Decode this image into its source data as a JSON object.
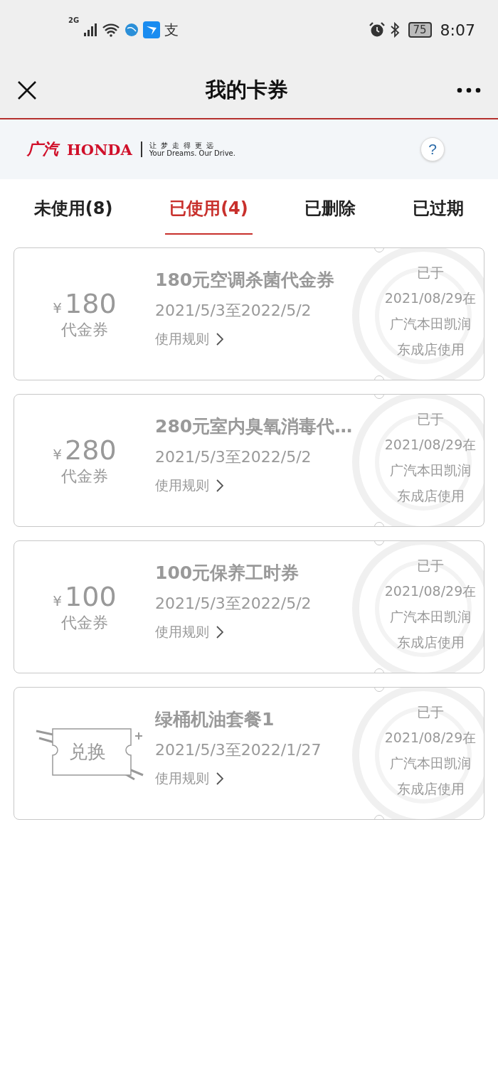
{
  "status_bar": {
    "network": "2G",
    "apps": [
      "支"
    ],
    "battery": "75",
    "time": "8:07"
  },
  "header": {
    "title": "我的卡券"
  },
  "brand": {
    "name_cn": "广汽",
    "name_en": "HONDA",
    "slogan_cn": "让梦走得更远",
    "slogan_en": "Your Dreams. Our Drive.",
    "help": "?"
  },
  "tabs": [
    {
      "label": "未使用(8)",
      "selected": false
    },
    {
      "label": "已使用(4)",
      "selected": true
    },
    {
      "label": "已删除",
      "selected": false
    },
    {
      "label": "已过期",
      "selected": false
    }
  ],
  "coupons": [
    {
      "kind": "voucher",
      "currency": "¥",
      "amount": "180",
      "type": "代金券",
      "title": "180元空调杀菌代金券",
      "validity": "2021/5/3至2022/5/2",
      "rules": "使用规则",
      "status": [
        "已于",
        "2021/08/29在",
        "广汽本田凯润",
        "东成店使用"
      ]
    },
    {
      "kind": "voucher",
      "currency": "¥",
      "amount": "280",
      "type": "代金券",
      "title": "280元室内臭氧消毒代…",
      "validity": "2021/5/3至2022/5/2",
      "rules": "使用规则",
      "status": [
        "已于",
        "2021/08/29在",
        "广汽本田凯润",
        "东成店使用"
      ]
    },
    {
      "kind": "voucher",
      "currency": "¥",
      "amount": "100",
      "type": "代金券",
      "title": "100元保养工时券",
      "validity": "2021/5/3至2022/5/2",
      "rules": "使用规则",
      "status": [
        "已于",
        "2021/08/29在",
        "广汽本田凯润",
        "东成店使用"
      ]
    },
    {
      "kind": "exchange",
      "badge": "兑换",
      "title": "绿桶机油套餐1",
      "validity": "2021/5/3至2022/1/27",
      "rules": "使用规则",
      "status": [
        "已于",
        "2021/08/29在",
        "广汽本田凯润",
        "东成店使用"
      ]
    }
  ]
}
